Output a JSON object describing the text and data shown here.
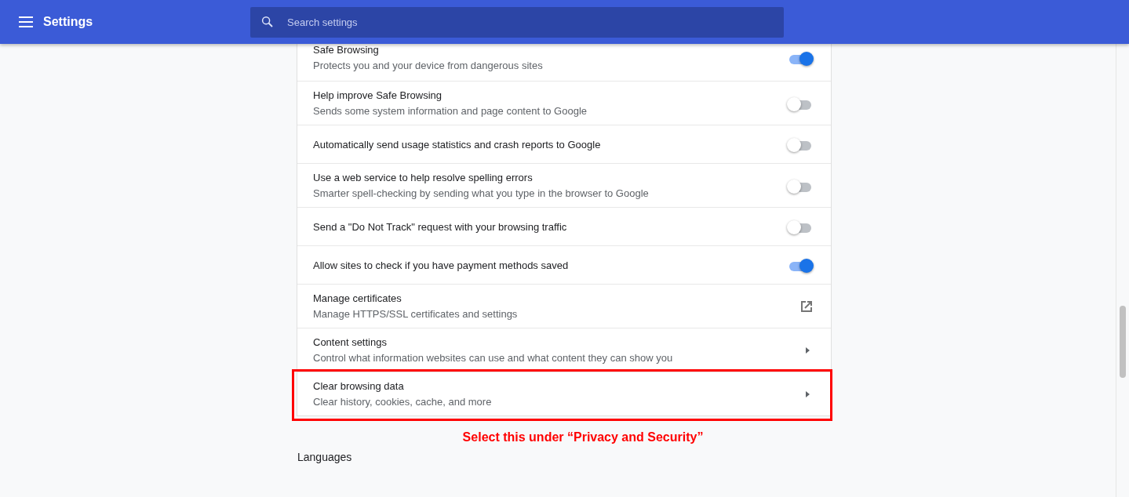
{
  "header": {
    "title": "Settings",
    "search": {
      "placeholder": "Search settings"
    }
  },
  "rows": [
    {
      "kind": "toggle",
      "title": "Safe Browsing",
      "description": "Protects you and your device from dangerous sites",
      "on": true,
      "highlighted": false
    },
    {
      "kind": "toggle",
      "title": "Help improve Safe Browsing",
      "description": "Sends some system information and page content to Google",
      "on": false,
      "highlighted": false
    },
    {
      "kind": "toggle",
      "title": "Automatically send usage statistics and crash reports to Google",
      "on": false,
      "highlighted": false
    },
    {
      "kind": "toggle",
      "title": "Use a web service to help resolve spelling errors",
      "description": "Smarter spell-checking by sending what you type in the browser to Google",
      "on": false,
      "highlighted": false
    },
    {
      "kind": "toggle",
      "title": "Send a \"Do Not Track\" request with your browsing traffic",
      "on": false,
      "highlighted": false
    },
    {
      "kind": "toggle",
      "title": "Allow sites to check if you have payment methods saved",
      "on": true,
      "highlighted": false
    },
    {
      "kind": "external",
      "title": "Manage certificates",
      "description": "Manage HTTPS/SSL certificates and settings",
      "highlighted": false
    },
    {
      "kind": "submenu",
      "title": "Content settings",
      "description": "Control what information websites can use and what content they can show you",
      "highlighted": false
    },
    {
      "kind": "submenu",
      "title": "Clear browsing data",
      "description": "Clear history, cookies, cache, and more",
      "highlighted": true
    }
  ],
  "annotation": "Select this under “Privacy and Security”",
  "next_section": "Languages"
}
